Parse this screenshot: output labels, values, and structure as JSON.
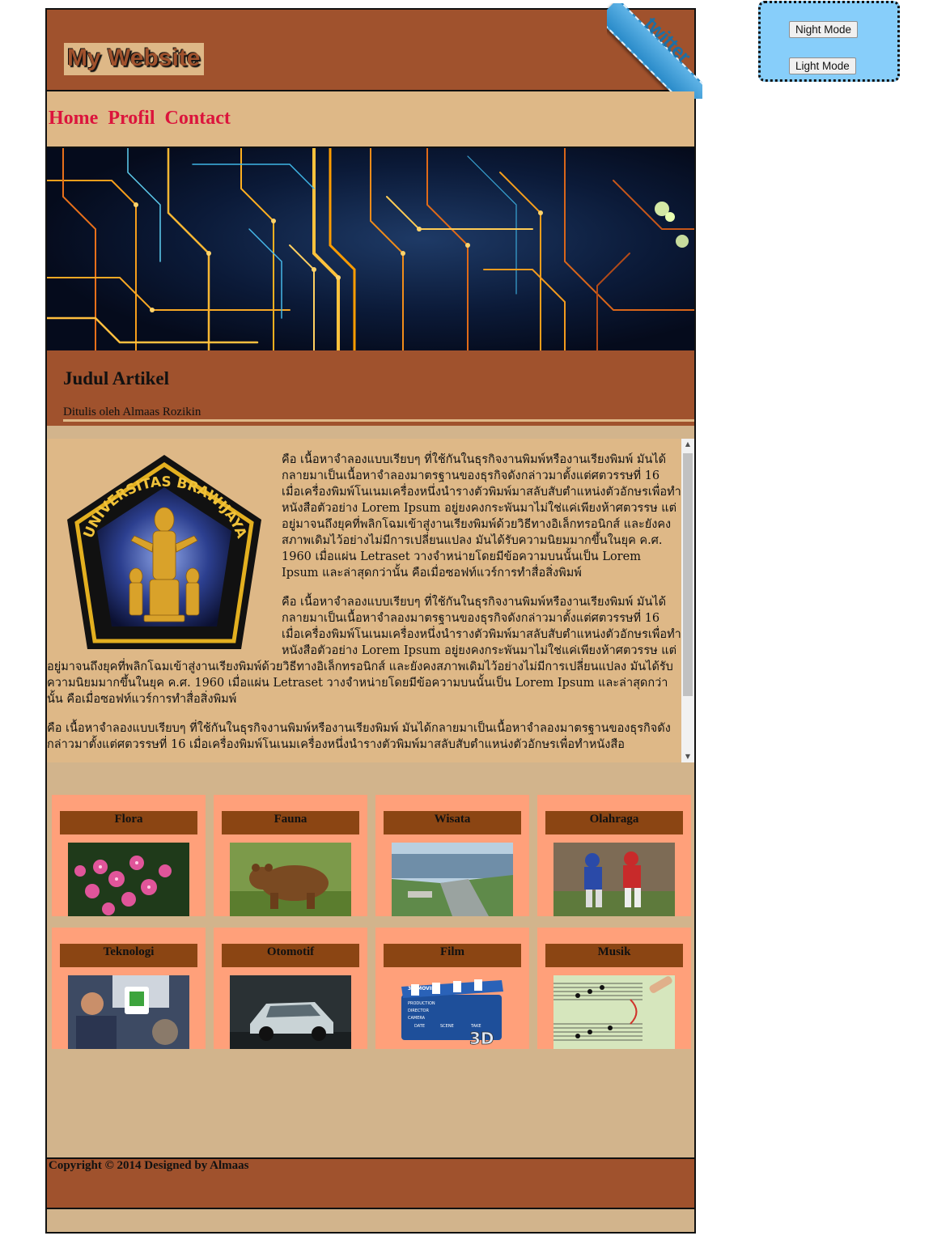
{
  "header": {
    "site_title": "My Website",
    "ribbon_text": "twitter"
  },
  "nav": {
    "items": [
      "Home",
      "Profil",
      "Contact"
    ]
  },
  "article": {
    "title": "Judul Artikel",
    "author": "Ditulis oleh Almaas Rozikin",
    "paragraphs": [
      "คือ เนื้อหาจำลองแบบเรียบๆ ที่ใช้กันในธุรกิจงานพิมพ์หรืองานเรียงพิมพ์ มันได้กลายมาเป็นเนื้อหาจำลองมาตรฐานของธุรกิจดังกล่าวมาตั้งแต่ศตวรรษที่ 16 เมื่อเครื่องพิมพ์โนเนมเครื่องหนึ่งนำรางตัวพิมพ์มาสลับสับตำแหน่งตัวอักษรเพื่อทำหนังสือตัวอย่าง Lorem Ipsum อยู่ยงคงกระพันมาไม่ใช่แค่เพียงห้าศตวรรษ แต่อยู่มาจนถึงยุคที่พลิกโฉมเข้าสู่งานเรียงพิมพ์ด้วยวิธีทางอิเล็กทรอนิกส์ และยังคงสภาพเดิมไว้อย่างไม่มีการเปลี่ยนแปลง มันได้รับความนิยมมากขึ้นในยุค ค.ศ. 1960 เมื่อแผ่น Letraset วางจำหน่ายโดยมีข้อความบนนั้นเป็น Lorem Ipsum และล่าสุดกว่านั้น คือเมื่อซอฟท์แวร์การทำสื่อสิ่งพิมพ์",
      "คือ เนื้อหาจำลองแบบเรียบๆ ที่ใช้กันในธุรกิจงานพิมพ์หรืองานเรียงพิมพ์ มันได้กลายมาเป็นเนื้อหาจำลองมาตรฐานของธุรกิจดังกล่าวมาตั้งแต่ศตวรรษที่ 16 เมื่อเครื่องพิมพ์โนเนมเครื่องหนึ่งนำรางตัวพิมพ์มาสลับสับตำแหน่งตัวอักษรเพื่อทำหนังสือตัวอย่าง Lorem Ipsum อยู่ยงคงกระพันมาไม่ใช่แค่เพียงห้าศตวรรษ แต่อยู่มาจนถึงยุคที่พลิกโฉมเข้าสู่งานเรียงพิมพ์ด้วยวิธีทางอิเล็กทรอนิกส์ และยังคงสภาพเดิมไว้อย่างไม่มีการเปลี่ยนแปลง มันได้รับความนิยมมากขึ้นในยุค ค.ศ. 1960 เมื่อแผ่น Letraset วางจำหน่ายโดยมีข้อความบนนั้นเป็น Lorem Ipsum และล่าสุดกว่านั้น คือเมื่อซอฟท์แวร์การทำสื่อสิ่งพิมพ์",
      "คือ เนื้อหาจำลองแบบเรียบๆ ที่ใช้กันในธุรกิจงานพิมพ์หรืองานเรียงพิมพ์ มันได้กลายมาเป็นเนื้อหาจำลองมาตรฐานของธุรกิจดังกล่าวมาตั้งแต่ศตวรรษที่ 16 เมื่อเครื่องพิมพ์โนเนมเครื่องหนึ่งนำรางตัวพิมพ์มาสลับสับตำแหน่งตัวอักษรเพื่อทำหนังสือ"
    ],
    "logo_text": "UNIVERSITAS BRAWIJAYA"
  },
  "gallery": {
    "categories": [
      "Flora",
      "Fauna",
      "Wisata",
      "Olahraga",
      "Teknologi",
      "Otomotif",
      "Film",
      "Musik"
    ]
  },
  "film_clapper": {
    "title": "3D MOVIES",
    "rows": [
      "PRODUCTION",
      "DIRECTOR",
      "CAMERA"
    ],
    "cols": [
      "DATE",
      "SCENE",
      "TAKE"
    ],
    "badge": "3D"
  },
  "footer": {
    "copyright": "Copyright © 2014 Designed by Almaas"
  },
  "mode": {
    "night_label": "Night Mode",
    "light_label": "Light Mode"
  },
  "colors": {
    "header_bg": "#a0522d",
    "nav_bg": "#deb887",
    "nav_link": "#dc143c",
    "page_bg": "#d2b48c",
    "card_bg": "#ffa07a",
    "card_label_bg": "#8b4513",
    "mode_box": "#87cefa"
  }
}
